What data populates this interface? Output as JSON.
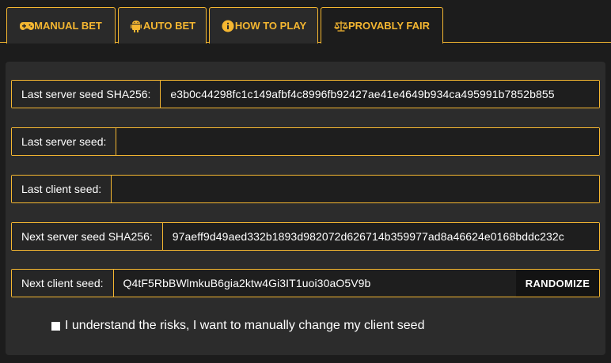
{
  "tabs": [
    {
      "label": "MANUAL BET",
      "icon": "gamepad-icon"
    },
    {
      "label": "AUTO BET",
      "icon": "android-icon"
    },
    {
      "label": "HOW TO PLAY",
      "icon": "info-icon"
    },
    {
      "label": "PROVABLY FAIR",
      "icon": "scales-icon"
    }
  ],
  "active_tab": "PROVABLY FAIR",
  "fields": {
    "last_server_seed_hash": {
      "label": "Last server seed SHA256:",
      "value": "e3b0c44298fc1c149afbf4c8996fb92427ae41e4649b934ca495991b7852b855"
    },
    "last_server_seed": {
      "label": "Last server seed:",
      "value": ""
    },
    "last_client_seed": {
      "label": "Last client seed:",
      "value": ""
    },
    "next_server_seed_hash": {
      "label": "Next server seed SHA256:",
      "value": "97aeff9d49aed332b1893d982072d626714b359977ad8a46624e0168bddc232c"
    },
    "next_client_seed": {
      "label": "Next client seed:",
      "value": "Q4tF5RbBWlmkuB6gia2ktw4Gi3IT1uoi30aO5V9b"
    }
  },
  "randomize_label": "RANDOMIZE",
  "risk_checkbox": {
    "label": "I understand the risks, I want to manually change my client seed",
    "checked": false
  },
  "colors": {
    "accent": "#f5b731",
    "background": "#1c1c1c",
    "panel": "#2c2c2c"
  }
}
